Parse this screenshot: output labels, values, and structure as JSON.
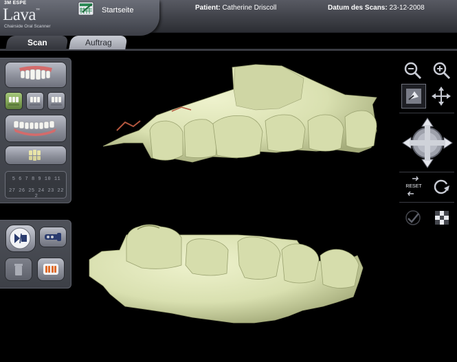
{
  "header": {
    "brand": "3M ESPE",
    "product": "Lava",
    "product_tm": "™",
    "tagline": "Chairside Oral Scanner",
    "home_label": "Startseite",
    "patient_label": "Patient:",
    "patient_name": "Catherine Driscoll",
    "scan_date_label": "Datum des Scans:",
    "scan_date": "23-12-2008"
  },
  "tabs": [
    {
      "label": "Scan",
      "active": true
    },
    {
      "label": "Auftrag",
      "active": false
    }
  ],
  "tooth_chart": {
    "upper": "5 6 7 8 9 10 11",
    "lower": "27 26 25 24 23 22 2"
  },
  "right_toolbar": {
    "reset_label": "RESET"
  },
  "colors": {
    "tooth_model": "#d9e0b0",
    "tooth_shadow": "#a4ab7a",
    "panel": "#474a52",
    "active_green": "#7ea153"
  }
}
